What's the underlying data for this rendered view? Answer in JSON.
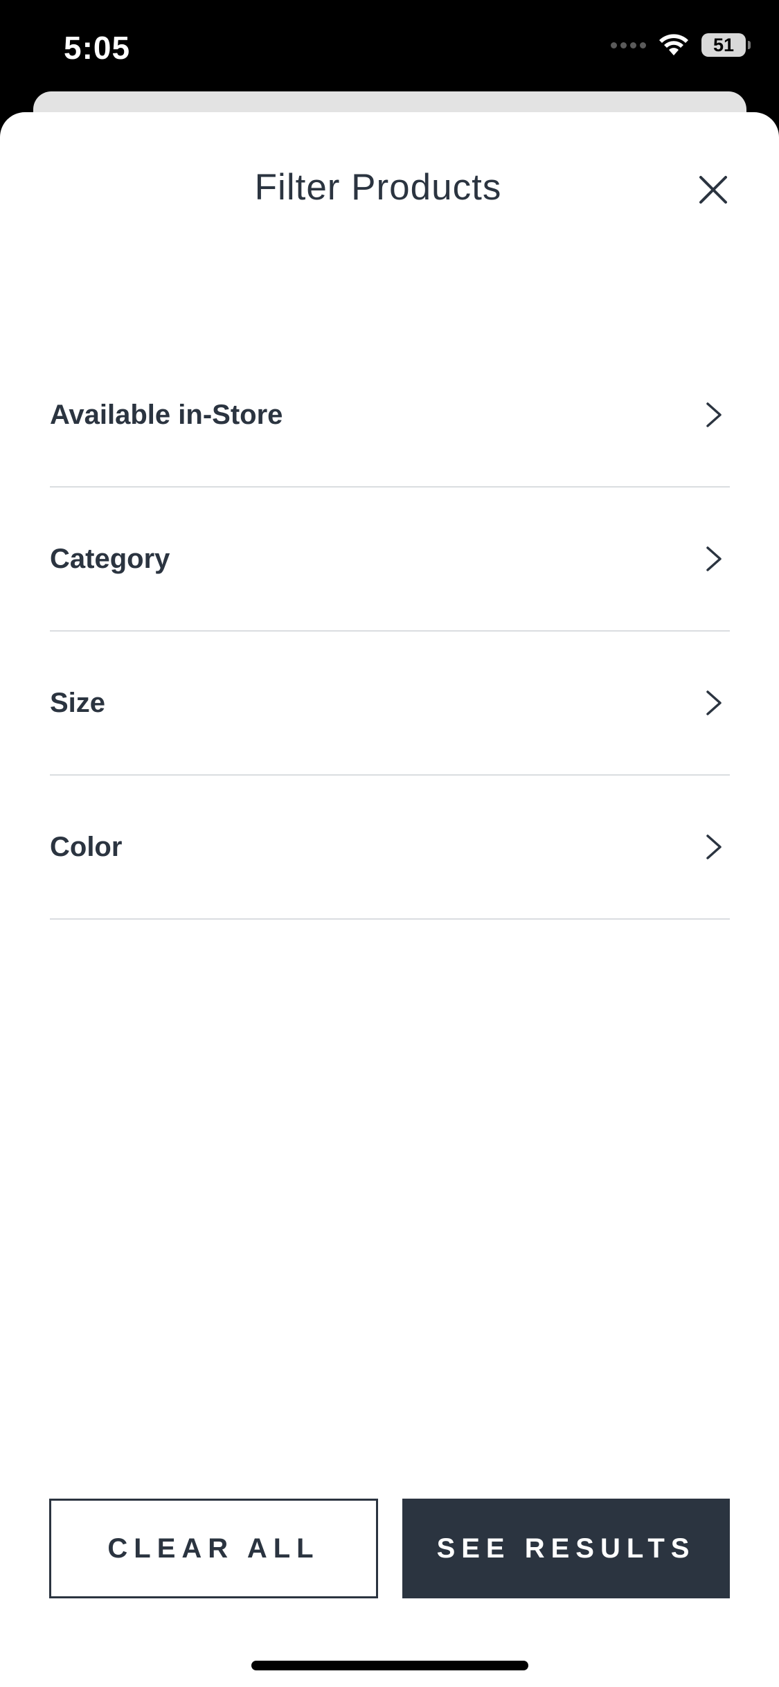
{
  "status_bar": {
    "time": "5:05",
    "battery": "51"
  },
  "sheet": {
    "title": "Filter Products"
  },
  "filters": [
    {
      "label": "Available in-Store"
    },
    {
      "label": "Category"
    },
    {
      "label": "Size"
    },
    {
      "label": "Color"
    }
  ],
  "actions": {
    "clear_label": "CLEAR ALL",
    "see_results_label": "SEE RESULTS"
  },
  "icons": {
    "close": "close-icon",
    "chevron": "chevron-right-icon",
    "wifi": "wifi-icon",
    "signal": "signal-icon",
    "battery": "battery-icon"
  },
  "colors": {
    "primary": "#2b3440",
    "divider": "#dadde0",
    "background": "#ffffff"
  }
}
